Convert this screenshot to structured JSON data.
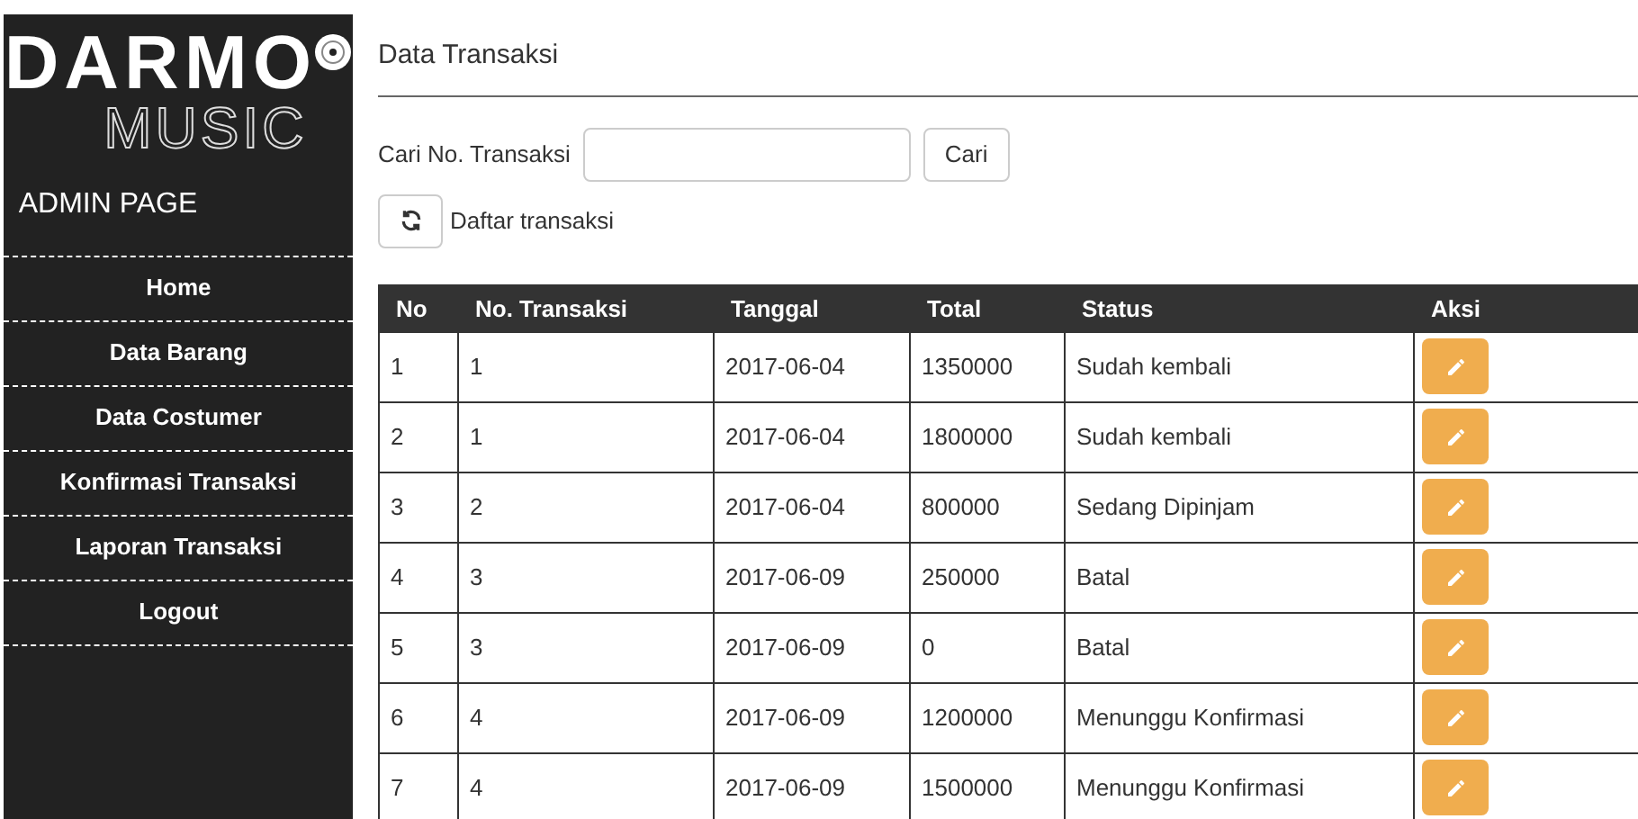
{
  "sidebar": {
    "logo": {
      "title": "DARMO",
      "subtitle": "MUSIC"
    },
    "heading": "ADMIN PAGE",
    "items": [
      {
        "label": "Home"
      },
      {
        "label": "Data Barang"
      },
      {
        "label": "Data Costumer"
      },
      {
        "label": "Konfirmasi Transaksi"
      },
      {
        "label": "Laporan Transaksi"
      },
      {
        "label": "Logout"
      }
    ]
  },
  "page_title": "Data Transaksi",
  "search": {
    "label": "Cari No. Transaksi",
    "button": "Cari"
  },
  "refresh_label": "Daftar transaksi",
  "table": {
    "columns": [
      "No",
      "No. Transaksi",
      "Tanggal",
      "Total",
      "Status",
      "Aksi"
    ],
    "rows": [
      [
        "1",
        "1",
        "2017-06-04",
        "1350000",
        "Sudah kembali"
      ],
      [
        "2",
        "1",
        "2017-06-04",
        "1800000",
        "Sudah kembali"
      ],
      [
        "3",
        "2",
        "2017-06-04",
        "800000",
        "Sedang Dipinjam"
      ],
      [
        "4",
        "3",
        "2017-06-09",
        "250000",
        "Batal"
      ],
      [
        "5",
        "3",
        "2017-06-09",
        "0",
        "Batal"
      ],
      [
        "6",
        "4",
        "2017-06-09",
        "1200000",
        "Menunggu Konfirmasi"
      ],
      [
        "7",
        "4",
        "2017-06-09",
        "1500000",
        "Menunggu Konfirmasi"
      ]
    ]
  }
}
